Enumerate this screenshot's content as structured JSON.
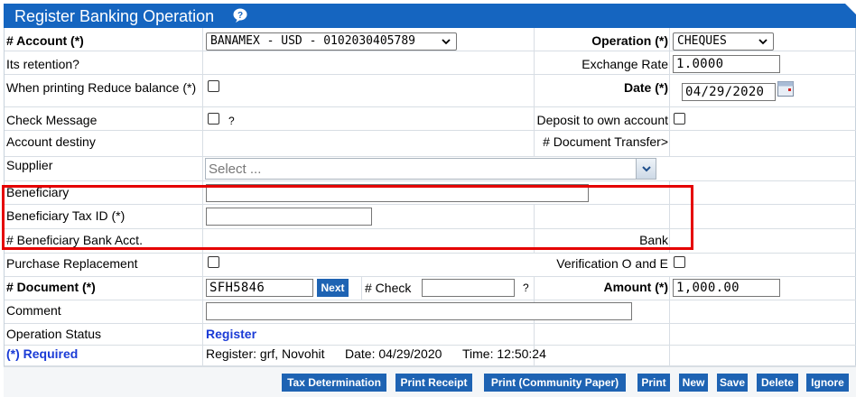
{
  "window": {
    "title": "Register Banking Operation",
    "help_icon": "help-bubble-icon"
  },
  "fields": {
    "account_label": "# Account (*)",
    "account_value": "BANAMEX - USD - 0102030405789",
    "operation_label": "Operation (*)",
    "operation_value": "CHEQUES",
    "retention_label": "Its retention?",
    "exchange_label": "Exchange Rate",
    "exchange_value": "1.0000",
    "reduce_label": "When printing Reduce balance (*)",
    "date_label": "Date (*)",
    "date_value": "04/29/2020",
    "check_message_label": "Check Message",
    "check_message_hint": "?",
    "deposit_label": "Deposit to own account",
    "account_destiny_label": "Account destiny",
    "doc_transfer_label": "# Document Transfer>",
    "supplier_label": "Supplier",
    "supplier_placeholder": "Select ...",
    "beneficiary_label": "Beneficiary",
    "beneficiary_value": "",
    "beneficiary_tax_label": "Beneficiary Tax ID (*)",
    "beneficiary_tax_value": "",
    "beneficiary_bank_label": "# Beneficiary Bank Acct.",
    "bank_label": "Bank",
    "purchase_label": "Purchase Replacement",
    "verification_label": "Verification O and E",
    "document_label": "# Document (*)",
    "document_value": "SFH5846",
    "next_label": "Next",
    "check_label": "# Check",
    "check_value": "",
    "check_hint": "?",
    "amount_label": "Amount (*)",
    "amount_value": "1,000.00",
    "comment_label": "Comment",
    "comment_value": "",
    "status_label": "Operation Status",
    "status_value": "Register",
    "required_label": "(*) Required",
    "register_info": "Register: grf, Novohit",
    "register_date": "Date: 04/29/2020",
    "register_time": "Time: 12:50:24"
  },
  "buttons": {
    "tax": "Tax Determination",
    "receipt": "Print Receipt",
    "community": "Print (Community Paper)",
    "print": "Print",
    "new": "New",
    "save": "Save",
    "delete": "Delete",
    "ignore": "Ignore"
  },
  "colors": {
    "header": "#1565c0",
    "button": "#1e63b3",
    "highlight": "#e50000",
    "status": "#1a3bd6"
  }
}
